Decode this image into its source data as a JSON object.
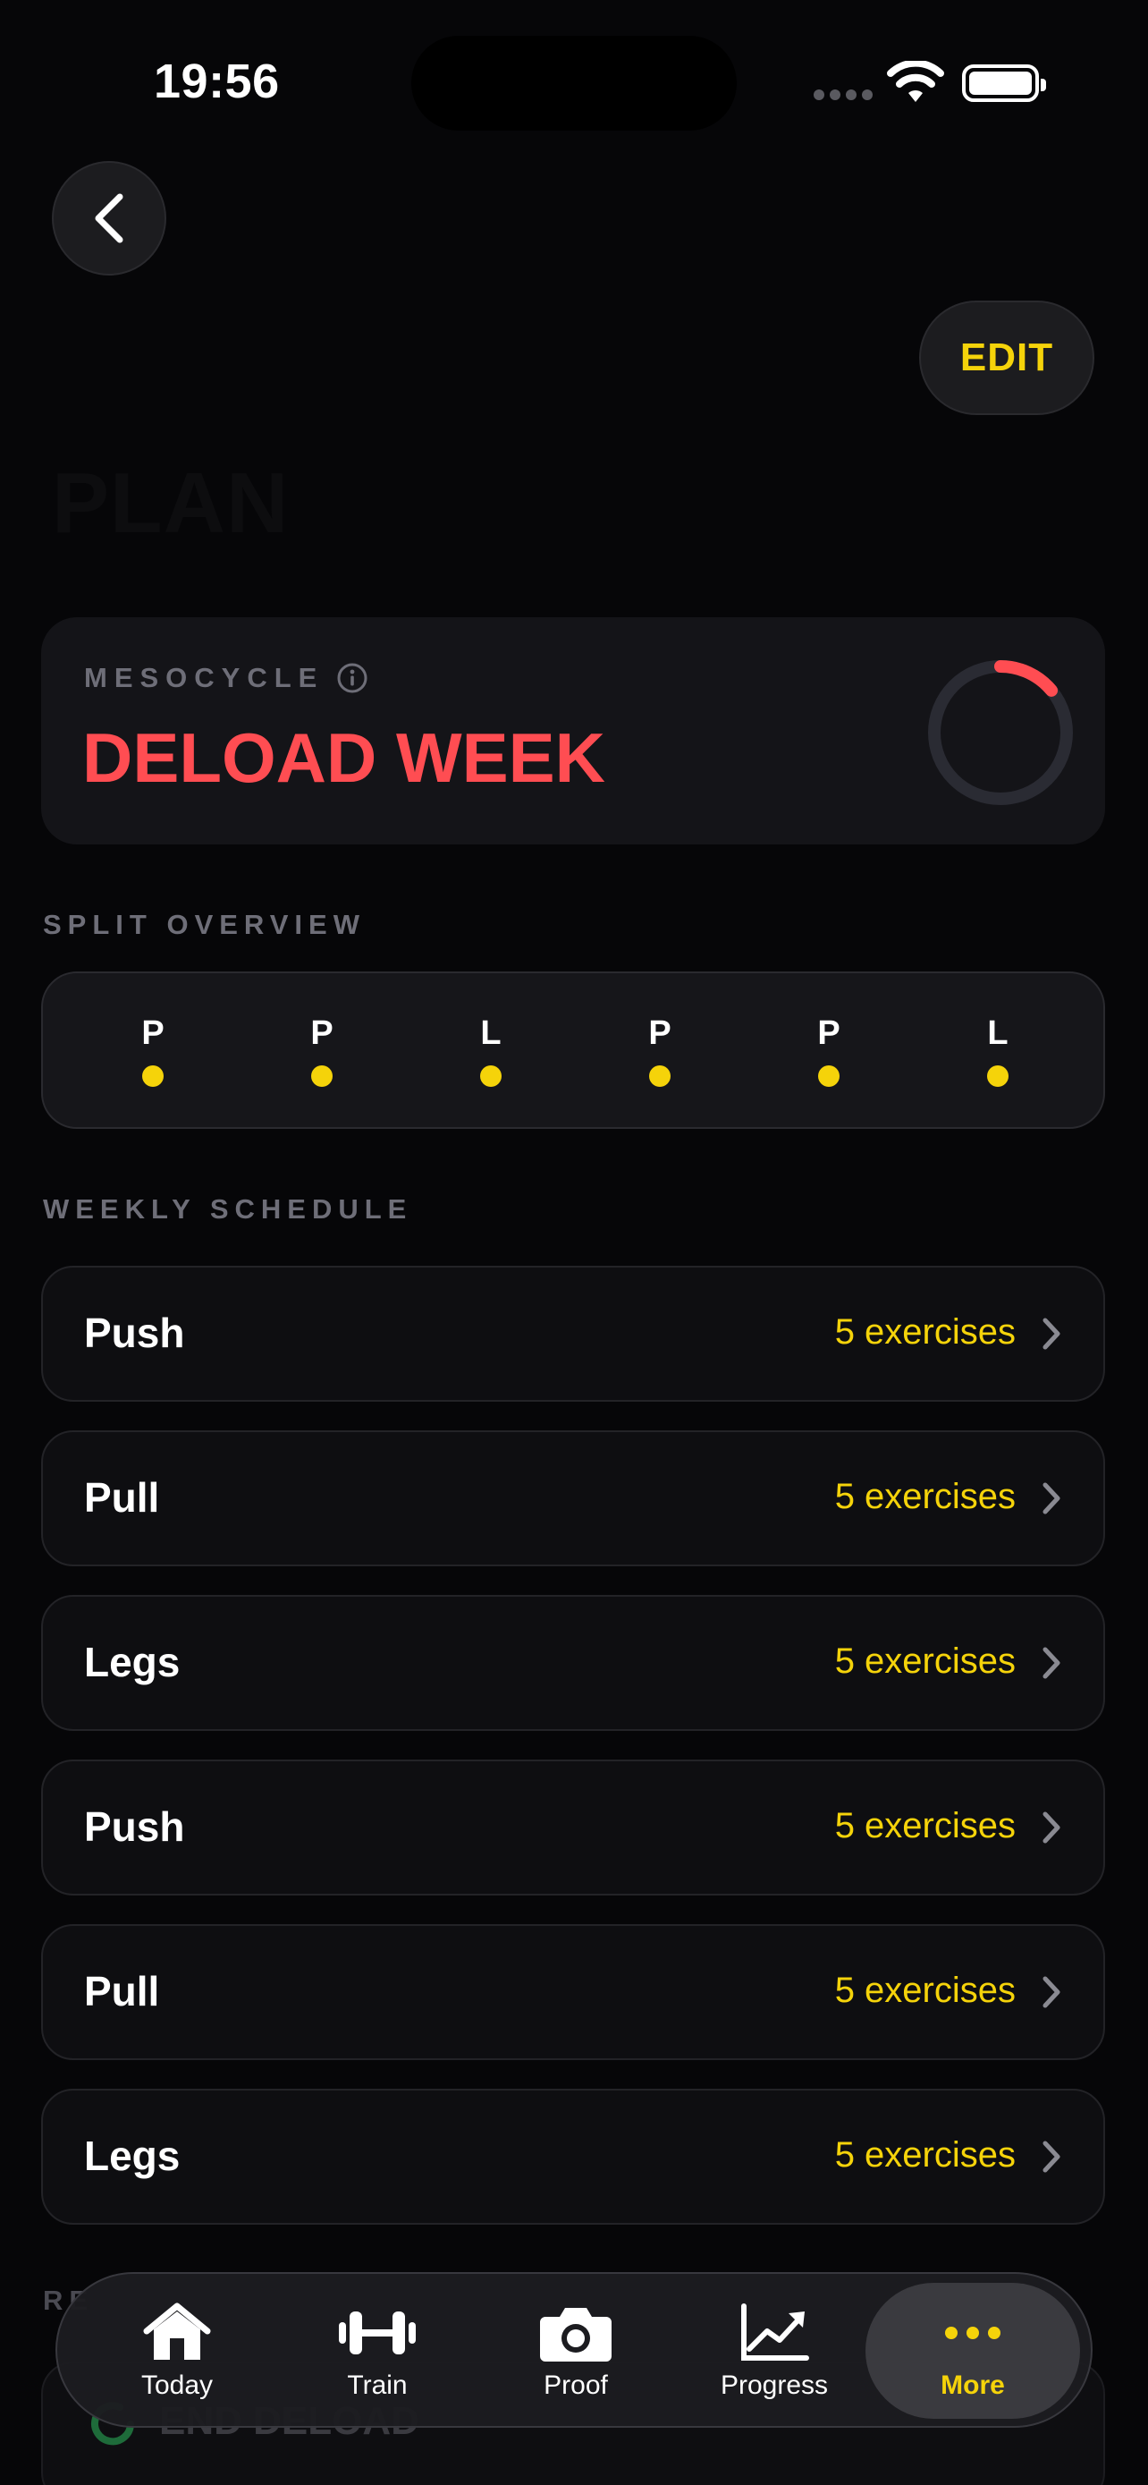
{
  "status_bar": {
    "time": "19:56"
  },
  "header": {
    "title": "PLAN",
    "edit_label": "EDIT"
  },
  "mesocycle": {
    "label": "MESOCYCLE",
    "value": "DELOAD WEEK",
    "progress": 0.14
  },
  "split_overview": {
    "label": "SPLIT OVERVIEW",
    "days": [
      "P",
      "P",
      "L",
      "P",
      "P",
      "L"
    ]
  },
  "weekly_schedule": {
    "label": "WEEKLY SCHEDULE",
    "rows": [
      {
        "name": "Push",
        "count": "5 exercises"
      },
      {
        "name": "Pull",
        "count": "5 exercises"
      },
      {
        "name": "Legs",
        "count": "5 exercises"
      },
      {
        "name": "Push",
        "count": "5 exercises"
      },
      {
        "name": "Pull",
        "count": "5 exercises"
      },
      {
        "name": "Legs",
        "count": "5 exercises"
      }
    ]
  },
  "peek": {
    "label": "RE",
    "action": "END DELOAD"
  },
  "tabbar": {
    "tabs": [
      {
        "label": "Today",
        "icon": "house-icon"
      },
      {
        "label": "Train",
        "icon": "dumbbell-icon"
      },
      {
        "label": "Proof",
        "icon": "camera-icon"
      },
      {
        "label": "Progress",
        "icon": "chart-icon"
      },
      {
        "label": "More",
        "icon": "more-icon"
      }
    ],
    "active": "More"
  },
  "colors": {
    "accent": "#f5d30a",
    "danger": "#ff4d52",
    "background": "#060608"
  }
}
